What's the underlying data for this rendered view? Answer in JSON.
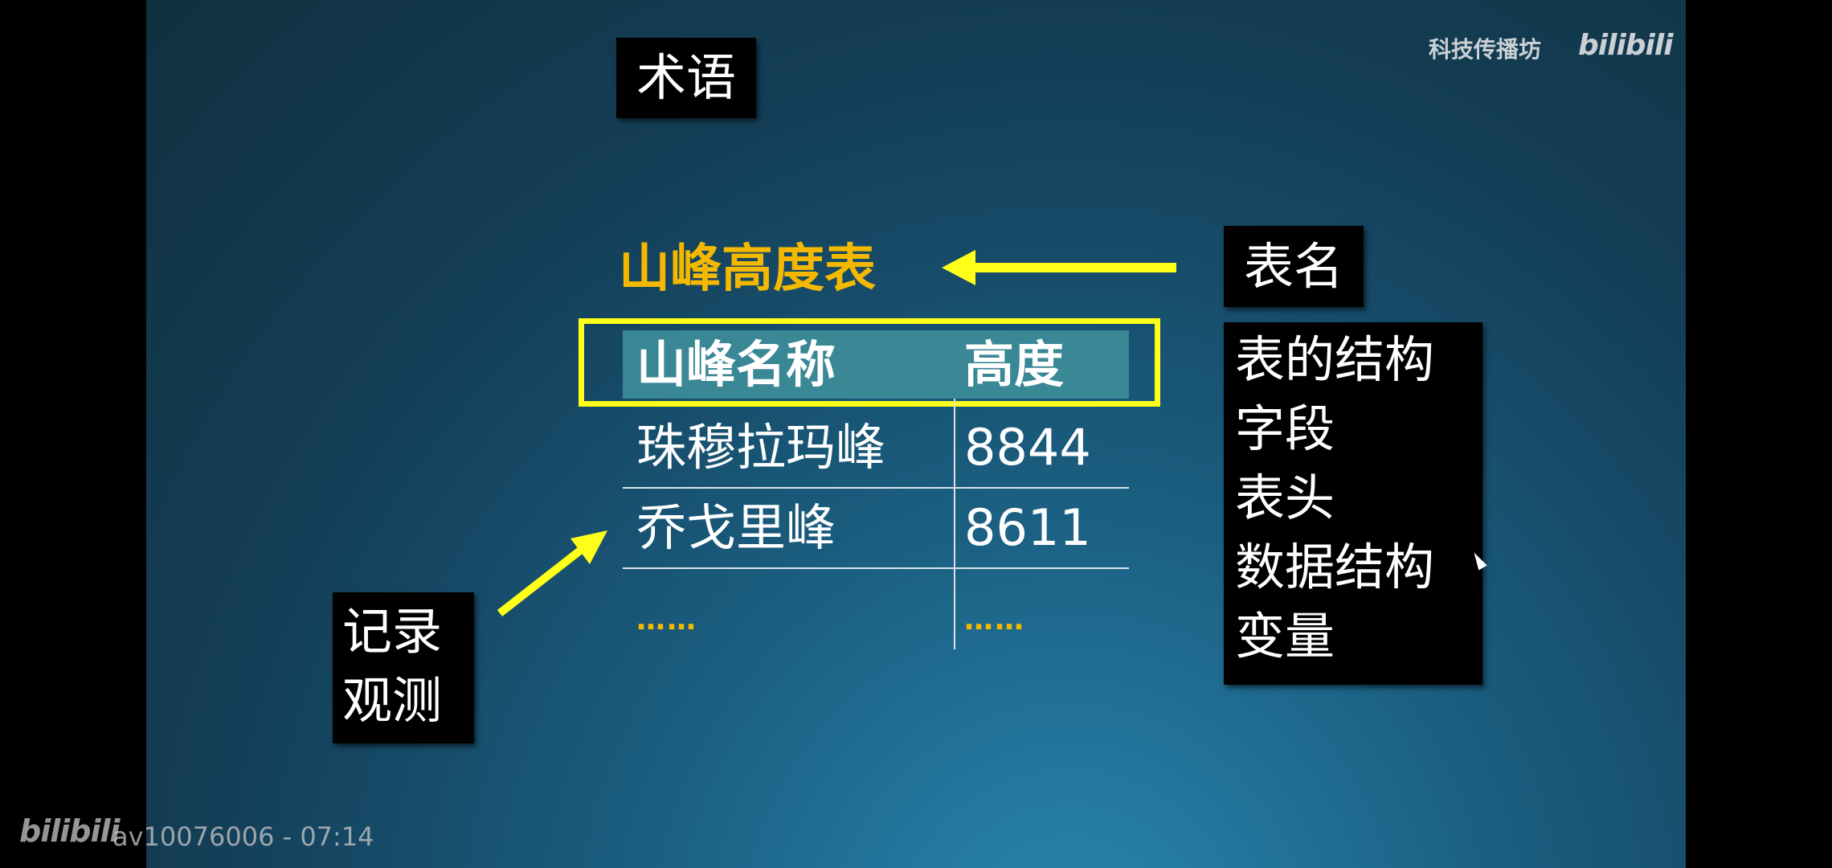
{
  "watermark": {
    "channel": "科技传播坊",
    "logo": "bilibili"
  },
  "slide": {
    "term_label": "术语",
    "table_title": "山峰高度表",
    "table_name_label": "表名",
    "synonyms": [
      "表的结构",
      "字段",
      "表头",
      "数据结构",
      "变量"
    ],
    "record_labels": [
      "记录",
      "观测"
    ],
    "table": {
      "columns": [
        "山峰名称",
        "高度"
      ],
      "rows": [
        [
          "珠穆拉玛峰",
          "8844"
        ],
        [
          "乔戈里峰",
          "8611"
        ],
        [
          "……",
          "……"
        ]
      ]
    },
    "colors": {
      "title": "#f5b800",
      "highlight_frame": "#ffff1a",
      "arrow": "#ffff1a",
      "header_band": "#3a8796"
    }
  },
  "player": {
    "logo": "bilibili",
    "info": "av10076006 - 07:14"
  }
}
